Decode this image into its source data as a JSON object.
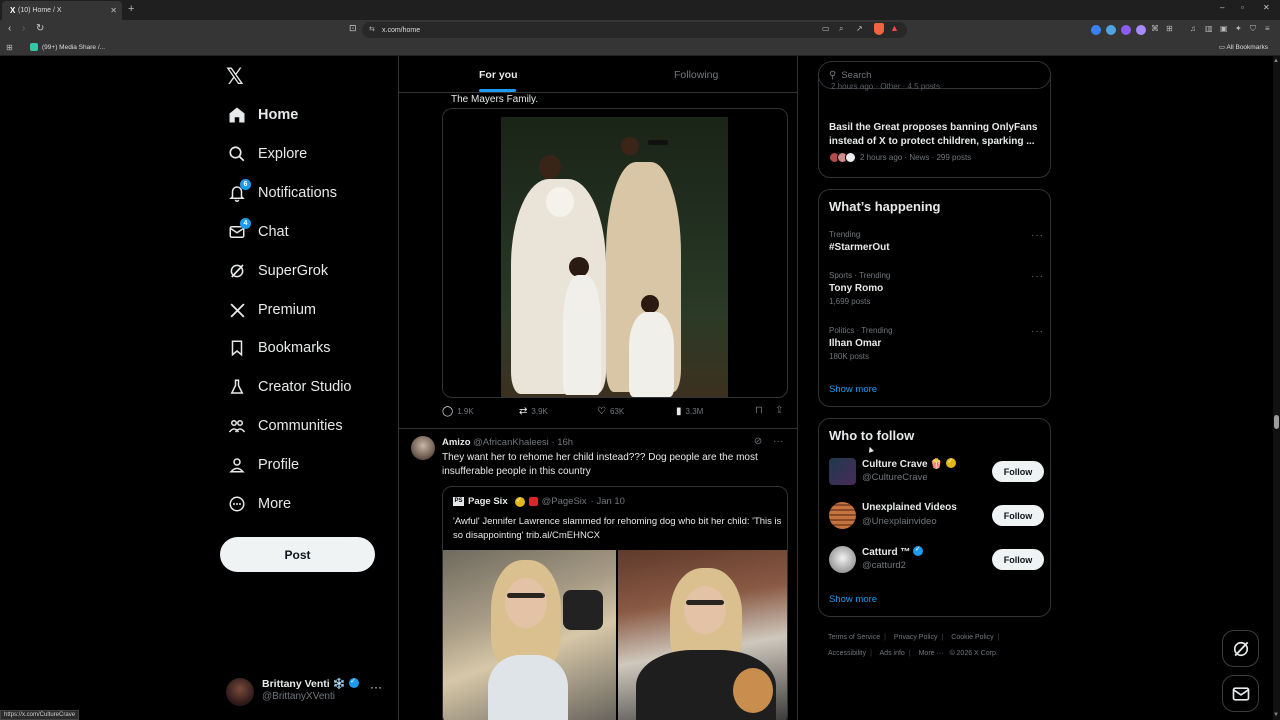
{
  "browser": {
    "tab_title": "(10) Home / X",
    "new_tab": "+",
    "url": "x.com/home",
    "bookmark_item": "(99+) Media Share /...",
    "all_bookmarks": "All Bookmarks",
    "status_url": "https://x.com/CultureCrave"
  },
  "sidebar": {
    "logo": "𝕏",
    "items": [
      {
        "label": "Home",
        "icon": "home-icon"
      },
      {
        "label": "Explore",
        "icon": "search-icon"
      },
      {
        "label": "Notifications",
        "icon": "bell-icon",
        "badge": "6"
      },
      {
        "label": "Chat",
        "icon": "mail-icon",
        "badge": "4"
      },
      {
        "label": "SuperGrok",
        "icon": "grok-icon"
      },
      {
        "label": "Premium",
        "icon": "x-icon"
      },
      {
        "label": "Bookmarks",
        "icon": "bookmark-icon"
      },
      {
        "label": "Creator Studio",
        "icon": "flask-icon"
      },
      {
        "label": "Communities",
        "icon": "people-icon"
      },
      {
        "label": "Profile",
        "icon": "person-icon"
      },
      {
        "label": "More",
        "icon": "more-circle-icon"
      }
    ],
    "post_label": "Post",
    "account": {
      "name": "Brittany Venti ❄️",
      "handle": "@BrittanyXVenti",
      "more": "···"
    }
  },
  "timeline": {
    "tabs": [
      {
        "label": "For you",
        "active": true
      },
      {
        "label": "Following",
        "active": false
      }
    ],
    "tweet1": {
      "caption": "The Mayers Family.",
      "stats": {
        "replies": "1.9K",
        "reposts": "3.9K",
        "likes": "63K",
        "views": "3.3M"
      }
    },
    "tweet2": {
      "name": "Amizo",
      "handle": "@AfricanKhaleesi",
      "time": "· 16h",
      "text": "They want her to rehome her child instead??? Dog people are the most insufferable people in this country",
      "quote": {
        "logo": "PS",
        "name": "Page Six",
        "handle": "@PageSix",
        "time": "· Jan 10",
        "text": "'Awful' Jennifer Lawrence slammed for rehoming dog who bit her child: 'This is so disappointing' trib.al/CmEHNCX"
      }
    }
  },
  "right": {
    "search_placeholder": "Search",
    "news": {
      "faded": "2 hours ago · Other · 4.5 posts",
      "title": "Basil the Great proposes banning OnlyFans instead of X to protect children, sparking ...",
      "meta": "2 hours ago · News · 299 posts"
    },
    "happening": {
      "title": "What’s happening",
      "trends": [
        {
          "meta": "Trending",
          "name": "#StarmerOut",
          "count": ""
        },
        {
          "meta": "Sports · Trending",
          "name": "Tony Romo",
          "count": "1,699 posts"
        },
        {
          "meta": "Politics · Trending",
          "name": "Ilhan Omar",
          "count": "180K posts"
        }
      ],
      "show_more": "Show more"
    },
    "follow": {
      "title": "Who to follow",
      "accounts": [
        {
          "name": "Culture Crave 🍿",
          "handle": "@CultureCrave",
          "button": "Follow",
          "verified": "gold"
        },
        {
          "name": "Unexplained Videos",
          "handle": "@Unexplainvideo",
          "button": "Follow",
          "verified": ""
        },
        {
          "name": "Catturd ™",
          "handle": "@catturd2",
          "button": "Follow",
          "verified": "blue"
        }
      ],
      "show_more": "Show more"
    },
    "footer": [
      "Terms of Service",
      "Privacy Policy",
      "Cookie Policy",
      "Accessibility",
      "Ads info",
      "More ···",
      "© 2026 X Corp."
    ]
  },
  "colors": {
    "accent": "#1d9bf0",
    "background": "#000000",
    "border": "#2f3336",
    "muted_text": "#71767b"
  }
}
